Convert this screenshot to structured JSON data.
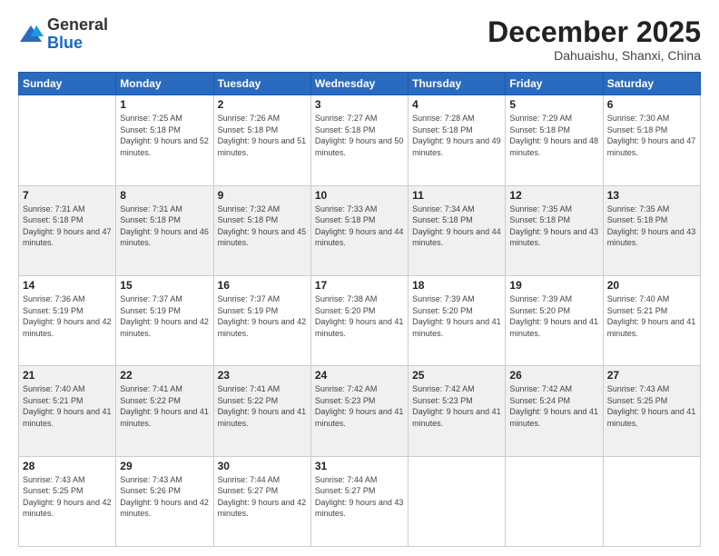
{
  "logo": {
    "general": "General",
    "blue": "Blue"
  },
  "header": {
    "month": "December 2025",
    "location": "Dahuaishu, Shanxi, China"
  },
  "weekdays": [
    "Sunday",
    "Monday",
    "Tuesday",
    "Wednesday",
    "Thursday",
    "Friday",
    "Saturday"
  ],
  "weeks": [
    [
      {
        "day": "",
        "sunrise": "",
        "sunset": "",
        "daylight": ""
      },
      {
        "day": "1",
        "sunrise": "Sunrise: 7:25 AM",
        "sunset": "Sunset: 5:18 PM",
        "daylight": "Daylight: 9 hours and 52 minutes."
      },
      {
        "day": "2",
        "sunrise": "Sunrise: 7:26 AM",
        "sunset": "Sunset: 5:18 PM",
        "daylight": "Daylight: 9 hours and 51 minutes."
      },
      {
        "day": "3",
        "sunrise": "Sunrise: 7:27 AM",
        "sunset": "Sunset: 5:18 PM",
        "daylight": "Daylight: 9 hours and 50 minutes."
      },
      {
        "day": "4",
        "sunrise": "Sunrise: 7:28 AM",
        "sunset": "Sunset: 5:18 PM",
        "daylight": "Daylight: 9 hours and 49 minutes."
      },
      {
        "day": "5",
        "sunrise": "Sunrise: 7:29 AM",
        "sunset": "Sunset: 5:18 PM",
        "daylight": "Daylight: 9 hours and 48 minutes."
      },
      {
        "day": "6",
        "sunrise": "Sunrise: 7:30 AM",
        "sunset": "Sunset: 5:18 PM",
        "daylight": "Daylight: 9 hours and 47 minutes."
      }
    ],
    [
      {
        "day": "7",
        "sunrise": "Sunrise: 7:31 AM",
        "sunset": "Sunset: 5:18 PM",
        "daylight": "Daylight: 9 hours and 47 minutes."
      },
      {
        "day": "8",
        "sunrise": "Sunrise: 7:31 AM",
        "sunset": "Sunset: 5:18 PM",
        "daylight": "Daylight: 9 hours and 46 minutes."
      },
      {
        "day": "9",
        "sunrise": "Sunrise: 7:32 AM",
        "sunset": "Sunset: 5:18 PM",
        "daylight": "Daylight: 9 hours and 45 minutes."
      },
      {
        "day": "10",
        "sunrise": "Sunrise: 7:33 AM",
        "sunset": "Sunset: 5:18 PM",
        "daylight": "Daylight: 9 hours and 44 minutes."
      },
      {
        "day": "11",
        "sunrise": "Sunrise: 7:34 AM",
        "sunset": "Sunset: 5:18 PM",
        "daylight": "Daylight: 9 hours and 44 minutes."
      },
      {
        "day": "12",
        "sunrise": "Sunrise: 7:35 AM",
        "sunset": "Sunset: 5:18 PM",
        "daylight": "Daylight: 9 hours and 43 minutes."
      },
      {
        "day": "13",
        "sunrise": "Sunrise: 7:35 AM",
        "sunset": "Sunset: 5:18 PM",
        "daylight": "Daylight: 9 hours and 43 minutes."
      }
    ],
    [
      {
        "day": "14",
        "sunrise": "Sunrise: 7:36 AM",
        "sunset": "Sunset: 5:19 PM",
        "daylight": "Daylight: 9 hours and 42 minutes."
      },
      {
        "day": "15",
        "sunrise": "Sunrise: 7:37 AM",
        "sunset": "Sunset: 5:19 PM",
        "daylight": "Daylight: 9 hours and 42 minutes."
      },
      {
        "day": "16",
        "sunrise": "Sunrise: 7:37 AM",
        "sunset": "Sunset: 5:19 PM",
        "daylight": "Daylight: 9 hours and 42 minutes."
      },
      {
        "day": "17",
        "sunrise": "Sunrise: 7:38 AM",
        "sunset": "Sunset: 5:20 PM",
        "daylight": "Daylight: 9 hours and 41 minutes."
      },
      {
        "day": "18",
        "sunrise": "Sunrise: 7:39 AM",
        "sunset": "Sunset: 5:20 PM",
        "daylight": "Daylight: 9 hours and 41 minutes."
      },
      {
        "day": "19",
        "sunrise": "Sunrise: 7:39 AM",
        "sunset": "Sunset: 5:20 PM",
        "daylight": "Daylight: 9 hours and 41 minutes."
      },
      {
        "day": "20",
        "sunrise": "Sunrise: 7:40 AM",
        "sunset": "Sunset: 5:21 PM",
        "daylight": "Daylight: 9 hours and 41 minutes."
      }
    ],
    [
      {
        "day": "21",
        "sunrise": "Sunrise: 7:40 AM",
        "sunset": "Sunset: 5:21 PM",
        "daylight": "Daylight: 9 hours and 41 minutes."
      },
      {
        "day": "22",
        "sunrise": "Sunrise: 7:41 AM",
        "sunset": "Sunset: 5:22 PM",
        "daylight": "Daylight: 9 hours and 41 minutes."
      },
      {
        "day": "23",
        "sunrise": "Sunrise: 7:41 AM",
        "sunset": "Sunset: 5:22 PM",
        "daylight": "Daylight: 9 hours and 41 minutes."
      },
      {
        "day": "24",
        "sunrise": "Sunrise: 7:42 AM",
        "sunset": "Sunset: 5:23 PM",
        "daylight": "Daylight: 9 hours and 41 minutes."
      },
      {
        "day": "25",
        "sunrise": "Sunrise: 7:42 AM",
        "sunset": "Sunset: 5:23 PM",
        "daylight": "Daylight: 9 hours and 41 minutes."
      },
      {
        "day": "26",
        "sunrise": "Sunrise: 7:42 AM",
        "sunset": "Sunset: 5:24 PM",
        "daylight": "Daylight: 9 hours and 41 minutes."
      },
      {
        "day": "27",
        "sunrise": "Sunrise: 7:43 AM",
        "sunset": "Sunset: 5:25 PM",
        "daylight": "Daylight: 9 hours and 41 minutes."
      }
    ],
    [
      {
        "day": "28",
        "sunrise": "Sunrise: 7:43 AM",
        "sunset": "Sunset: 5:25 PM",
        "daylight": "Daylight: 9 hours and 42 minutes."
      },
      {
        "day": "29",
        "sunrise": "Sunrise: 7:43 AM",
        "sunset": "Sunset: 5:26 PM",
        "daylight": "Daylight: 9 hours and 42 minutes."
      },
      {
        "day": "30",
        "sunrise": "Sunrise: 7:44 AM",
        "sunset": "Sunset: 5:27 PM",
        "daylight": "Daylight: 9 hours and 42 minutes."
      },
      {
        "day": "31",
        "sunrise": "Sunrise: 7:44 AM",
        "sunset": "Sunset: 5:27 PM",
        "daylight": "Daylight: 9 hours and 43 minutes."
      },
      {
        "day": "",
        "sunrise": "",
        "sunset": "",
        "daylight": ""
      },
      {
        "day": "",
        "sunrise": "",
        "sunset": "",
        "daylight": ""
      },
      {
        "day": "",
        "sunrise": "",
        "sunset": "",
        "daylight": ""
      }
    ]
  ]
}
